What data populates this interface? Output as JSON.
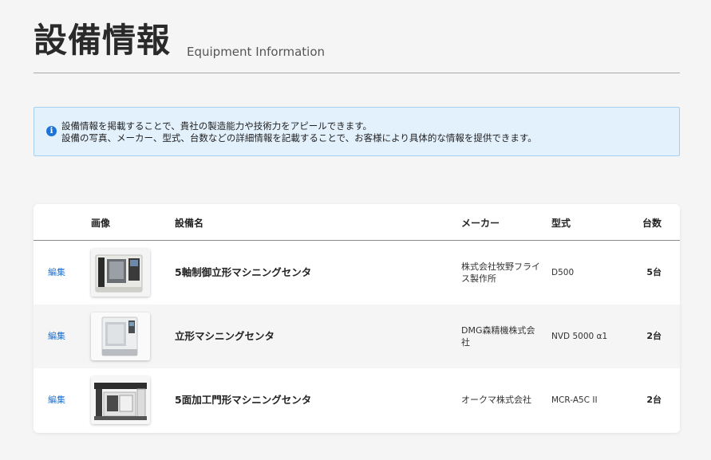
{
  "header": {
    "title": "設備情報",
    "subtitle": "Equipment Information"
  },
  "info": {
    "icon": "info-icon",
    "line1": "設備情報を掲載することで、貴社の製造能力や技術力をアピールできます。",
    "line2": "設備の写真、メーカー、型式、台数などの詳細情報を記載することで、お客様により具体的な情報を提供できます。"
  },
  "table": {
    "columns": {
      "image": "画像",
      "name": "設備名",
      "maker": "メーカー",
      "model": "型式",
      "count": "台数"
    },
    "rows": [
      {
        "edit": "編集",
        "image": "machining-center-thumbnail",
        "name": "5軸制御立形マシニングセンタ",
        "maker": "株式会社牧野フライス製作所",
        "model": "D500",
        "count": "5台"
      },
      {
        "edit": "編集",
        "image": "vertical-machining-center-thumbnail",
        "name": "立形マシニングセンタ",
        "maker": "DMG森精機株式会社",
        "model": "NVD 5000 α1",
        "count": "2台"
      },
      {
        "edit": "編集",
        "image": "gantry-machining-center-thumbnail",
        "name": "5面加工門形マシニングセンタ",
        "maker": "オークマ株式会社",
        "model": "MCR-A5C II",
        "count": "2台"
      }
    ]
  },
  "colors": {
    "accent": "#1e74d6",
    "info_bg": "#e3f1fd",
    "info_border": "#a9cfef"
  }
}
